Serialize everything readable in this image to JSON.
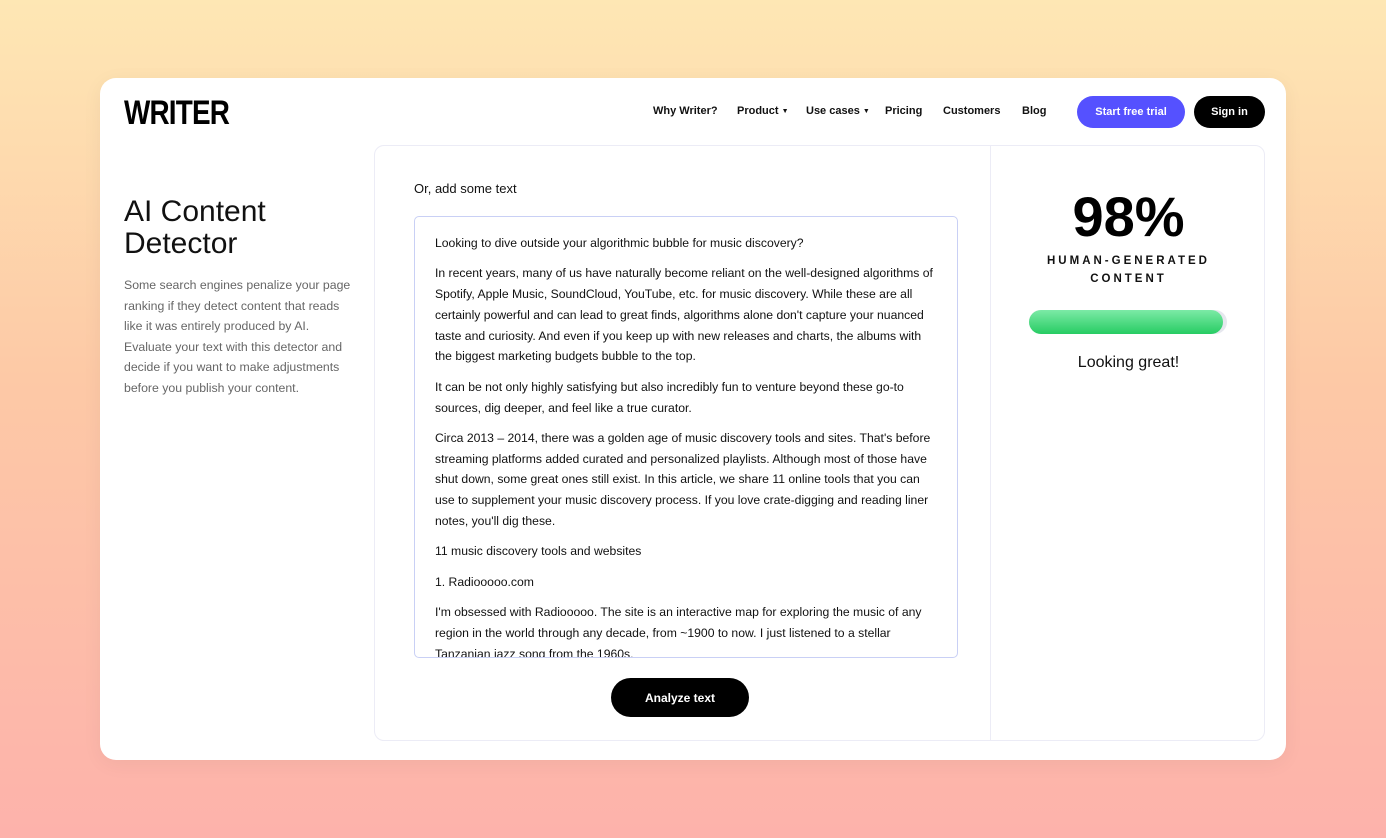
{
  "brand": "WRITER",
  "nav": {
    "items": [
      {
        "label": "Why Writer?",
        "dropdown": false
      },
      {
        "label": "Product",
        "dropdown": true
      },
      {
        "label": "Use cases",
        "dropdown": true
      },
      {
        "label": "Pricing",
        "dropdown": false
      },
      {
        "label": "Customers",
        "dropdown": false
      },
      {
        "label": "Blog",
        "dropdown": false
      }
    ],
    "trial_label": "Start free trial",
    "signin_label": "Sign in"
  },
  "hero": {
    "title": "AI Content Detector",
    "description": "Some search engines penalize your page ranking if they detect content that reads like it was entirely produced by AI. Evaluate your text with this detector and decide if you want to make adjustments before you publish your content."
  },
  "editor": {
    "label": "Or, add some text",
    "paragraphs": [
      "Looking to dive outside your algorithmic bubble for music discovery?",
      "In recent years, many of us have naturally become reliant on the well-designed algorithms of Spotify, Apple Music, SoundCloud, YouTube, etc. for music discovery. While these are all certainly powerful and can lead to great finds, algorithms alone don't capture your nuanced taste and curiosity. And even if you keep up with new releases and charts, the albums with the biggest marketing budgets bubble to the top.",
      "It can be not only highly satisfying but also incredibly fun to venture beyond these go-to sources, dig deeper, and feel like a true curator.",
      "Circa 2013 – 2014, there was a golden age of music discovery tools and sites. That's before streaming platforms added curated and personalized playlists. Although most of those have shut down, some great ones still exist. In this article, we share 11 online tools that you can use to supplement your music discovery process. If you love crate-digging and reading liner notes, you'll dig these.",
      "11 music discovery tools and websites",
      "1. Radiooooo.com",
      "I'm obsessed with Radiooooo. The site is an interactive map for exploring the music of any region in the world through any decade, from ~1900 to now. I just listened to a stellar Tanzanian jazz song from the 1960s."
    ],
    "analyze_label": "Analyze text"
  },
  "result": {
    "percent_label": "98%",
    "percent": 98,
    "caption": "HUMAN-GENERATED CONTENT",
    "message": "Looking great!",
    "bar_color": "#2dce69",
    "accent": "#5551ff"
  }
}
